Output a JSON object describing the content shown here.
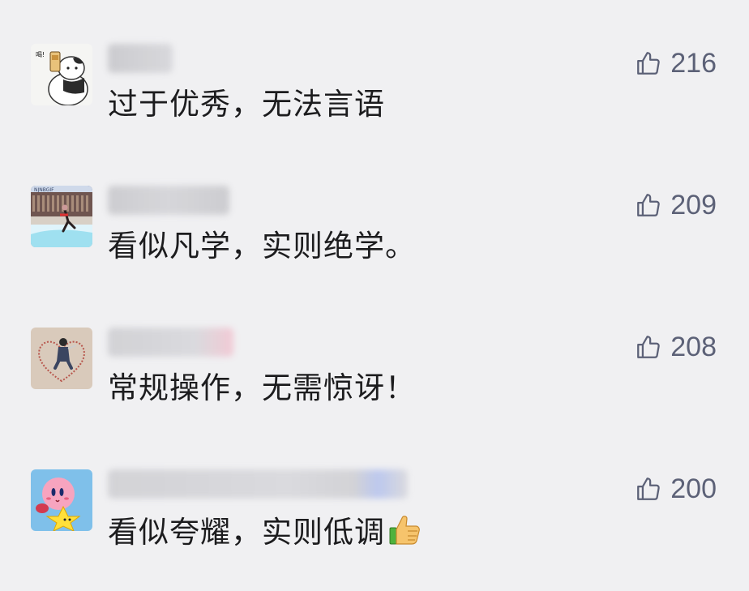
{
  "comments": [
    {
      "text": "过于优秀，无法言语",
      "likes": "216",
      "nickname_blur_colors": [
        "#c8c8cc",
        "#d6d6da"
      ],
      "avatar": "cat-drinking-avatar"
    },
    {
      "text": "看似凡学，实则绝学。",
      "likes": "209",
      "nickname_blur_colors": [
        "#c9c9cd",
        "#d4d4d8"
      ],
      "avatar": "stadium-jump-avatar"
    },
    {
      "text": "常规操作，无需惊讶！",
      "likes": "208",
      "nickname_blur_colors": [
        "#cfcfd3",
        "#f2c6d2"
      ],
      "avatar": "heart-sand-avatar"
    },
    {
      "text": "看似夸耀，实则低调",
      "likes": "200",
      "emoji": "thumbs-up-emoji",
      "nickname_blur_colors": [
        "#d0d0d4",
        "#b7c4ee"
      ],
      "avatar": "kirby-star-avatar"
    }
  ],
  "icons": {
    "like": "thumbs-up-outline-icon"
  },
  "colors": {
    "background": "#f0f0f2",
    "text": "#1c1c1e",
    "like": "#5c6177"
  }
}
